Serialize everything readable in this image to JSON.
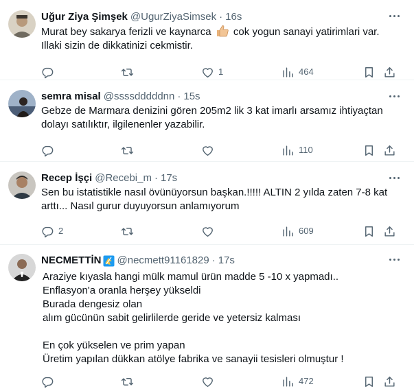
{
  "tweets": [
    {
      "name": "Uğur Ziya Şimşek",
      "handle": "@UgurZiyaSimsek",
      "separator": "·",
      "time": "16s",
      "lines": [
        {
          "before": "Murat bey sakarya ferizli ve kaynarca ",
          "emoji": "thumbs-up",
          "after": " cok yogun sanayi yatirimlari var."
        },
        {
          "text": "Illaki sizin de dikkatinizi cekmistir."
        }
      ],
      "replies": "",
      "reposts": "",
      "likes": "1",
      "views": "464"
    },
    {
      "name": "semra misal",
      "handle": "@ssssdddddnn",
      "separator": "·",
      "time": "15s",
      "lines": [
        {
          "text": "Gebze de Marmara denizini gören 205m2 lik 3 kat imarlı arsamız ihtiyaçtan"
        },
        {
          "text": "dolayı satılıktır, ilgilenenler yazabilir."
        }
      ],
      "replies": "",
      "reposts": "",
      "likes": "",
      "views": "110"
    },
    {
      "name": "Recep İşçi",
      "handle": "@Recebi_m",
      "separator": "·",
      "time": "17s",
      "lines": [
        {
          "text": "Sen bu istatistikle nasıl övünüyorsun başkan.!!!!! ALTIN 2 yılda zaten 7-8 kat"
        },
        {
          "text": "arttı... Nasıl gurur duyuyorsun anlamıyorum"
        }
      ],
      "replies": "2",
      "reposts": "",
      "likes": "",
      "views": "609"
    },
    {
      "name": "NECMETTİN",
      "handle": "@necmett91161829",
      "separator": "·",
      "time": "17s",
      "lines": [
        {
          "text": "Araziye kıyasla hangi mülk mamul ürün madde 5 -10 x yapmadı.."
        },
        {
          "text": "Enflasyon'a oranla herşey yükseldi"
        },
        {
          "text": "Burada dengesiz olan"
        },
        {
          "text": "alım gücünün sabit gelirlilerde geride ve yetersiz kalması"
        },
        {
          "text": ""
        },
        {
          "text": "En çok yükselen ve prim yapan"
        },
        {
          "text": "Üretim yapılan dükkan atölye fabrika  ve sanayii tesisleri olmuştur !"
        }
      ],
      "replies": "",
      "reposts": "",
      "likes": "",
      "views": "472"
    }
  ],
  "icons": {
    "reply": "reply-icon",
    "repost": "repost-icon",
    "like": "heart-icon",
    "views": "views-icon",
    "bookmark": "bookmark-icon",
    "share": "share-icon",
    "more": "more-icon"
  },
  "colors": {
    "text": "#0f1419",
    "secondary": "#536471",
    "border": "#eff3f4",
    "badge": "#1d9bf0"
  }
}
